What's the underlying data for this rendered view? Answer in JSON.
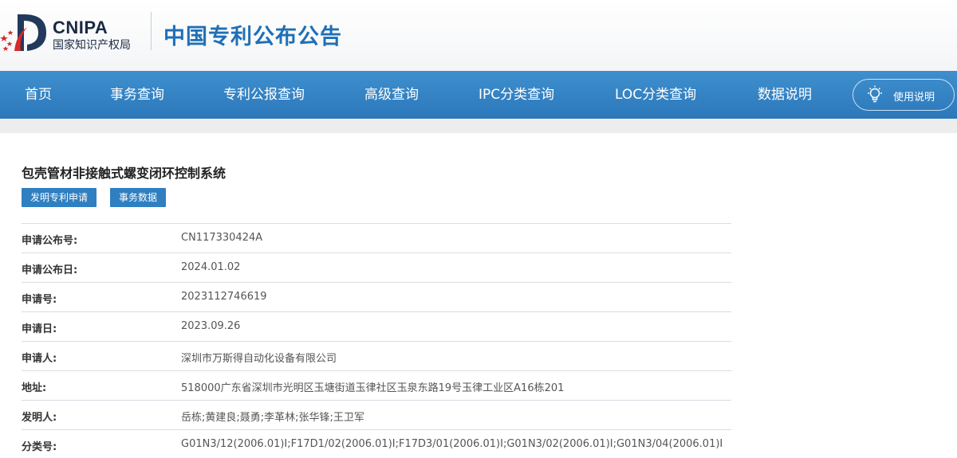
{
  "header": {
    "logo_en": "CNIPA",
    "logo_cn": "国家知识产权局",
    "site_title": "中国专利公布公告"
  },
  "nav": {
    "items": [
      "首页",
      "事务查询",
      "专利公报查询",
      "高级查询",
      "IPC分类查询",
      "LOC分类查询",
      "数据说明"
    ],
    "help_label": "使用说明",
    "help_icon": "lightbulb-icon"
  },
  "colors": {
    "nav_bg": "#2f80c2",
    "title_blue": "#1f6fb6",
    "tag_bg": "#2f7fc1",
    "logo_red": "#d42a2a"
  },
  "document": {
    "title": "包壳管材非接触式螺变闭环控制系统",
    "tags": [
      "发明专利申请",
      "事务数据"
    ],
    "fields": [
      {
        "label": "申请公布号:",
        "value": "CN117330424A"
      },
      {
        "label": "申请公布日:",
        "value": "2024.01.02"
      },
      {
        "label": "申请号:",
        "value": "2023112746619"
      },
      {
        "label": "申请日:",
        "value": "2023.09.26"
      },
      {
        "label": "申请人:",
        "value": "深圳市万斯得自动化设备有限公司"
      },
      {
        "label": "地址:",
        "value": "518000广东省深圳市光明区玉塘街道玉律社区玉泉东路19号玉律工业区A16栋201"
      },
      {
        "label": "发明人:",
        "value": "岳栋;黄建良;聂勇;李革林;张华锋;王卫军"
      },
      {
        "label": "分类号:",
        "value": "G01N3/12(2006.01)I;F17D1/02(2006.01)I;F17D3/01(2006.01)I;G01N3/02(2006.01)I;G01N3/04(2006.01)I"
      }
    ]
  }
}
